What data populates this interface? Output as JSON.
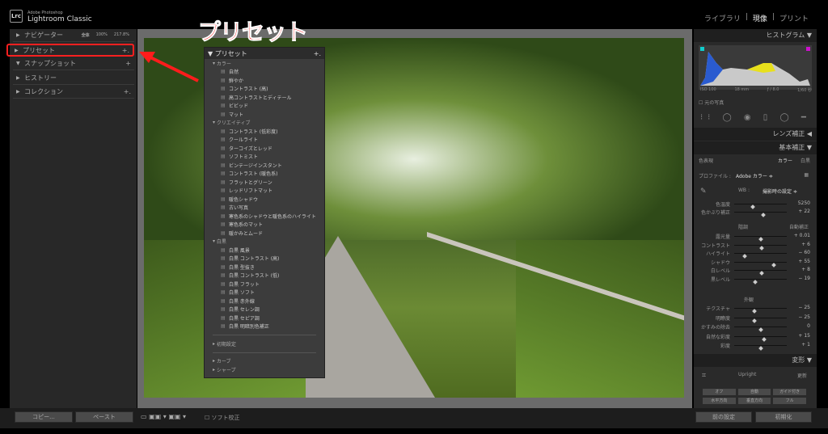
{
  "app": {
    "logo": "Lrc",
    "brand_small": "Adobe Photoshop",
    "brand": "Lightroom Classic",
    "modules": [
      "ライブラリ",
      "現像",
      "プリント"
    ],
    "active_module": "現像"
  },
  "annotation": {
    "title": "プリセット",
    "color": "#ff1c1c"
  },
  "left": {
    "navigator": {
      "label": "ナビゲーター",
      "fit": "全体",
      "z1": "100%",
      "z2": "217.8%"
    },
    "panels": [
      {
        "label": "プリセット",
        "plus": "+."
      },
      {
        "label": "スナップショット",
        "plus": "+"
      },
      {
        "label": "ヒストリー",
        "plus": ""
      },
      {
        "label": "コレクション",
        "plus": "+."
      }
    ]
  },
  "presets_popup": {
    "title": "プリセット",
    "plus": "+.",
    "groups": [
      {
        "name": "カラー",
        "items": [
          "自然",
          "鮮やか",
          "コントラスト (高)",
          "高コントラストとディテール",
          "ビビッド",
          "マット"
        ]
      },
      {
        "name": "クリエイティブ",
        "items": [
          "コントラスト (低彩度)",
          "クールライト",
          "ターコイズとレッド",
          "ソフトミスト",
          "ビンテージインスタント",
          "コントラスト (暖色系)",
          "フラットとグリーン",
          "レッドリフトマット",
          "暖色シャドウ",
          "古い写真",
          "寒色系のシャドウと暖色系のハイライト",
          "寒色系のマット",
          "暖かみとムード"
        ]
      },
      {
        "name": "白黒",
        "items": [
          "白黒 風景",
          "白黒 コントラスト (高)",
          "白黒 型抜き",
          "白黒 コントラスト (低)",
          "白黒 フラット",
          "白黒 ソフト",
          "白黒 赤外線",
          "白黒 セレン調",
          "白黒 セピア調",
          "白黒 明暗別色補正"
        ]
      }
    ],
    "collapsed": [
      "初期設定",
      "カーブ",
      "シャープ"
    ]
  },
  "right": {
    "histogram": {
      "title": "ヒストグラム",
      "iso": "ISO 100",
      "focal": "18 mm",
      "aperture": "ƒ / 8.0",
      "shutter": "1/60 秒",
      "original": "元の写真"
    },
    "lens": "レンズ補正",
    "basic": "基本補正",
    "treatment": {
      "label": "色表現",
      "color": "カラー",
      "bw": "白黒"
    },
    "profile": {
      "label": "プロファイル :",
      "value": "Adobe カラー ≑"
    },
    "wb": {
      "label": "WB :",
      "value": "撮影時の設定 ≑"
    },
    "sliders_wb": [
      {
        "label": "色温度",
        "value": "5250",
        "pos": 0.35
      },
      {
        "label": "色かぶり補正",
        "value": "+ 22",
        "pos": 0.55
      }
    ],
    "tone": {
      "label": "階調",
      "auto": "自動補正"
    },
    "sliders_tone": [
      {
        "label": "露光量",
        "value": "+ 0.01",
        "pos": 0.5
      },
      {
        "label": "コントラスト",
        "value": "+ 6",
        "pos": 0.53
      },
      {
        "label": "ハイライト",
        "value": "− 60",
        "pos": 0.2
      },
      {
        "label": "シャドウ",
        "value": "+ 55",
        "pos": 0.75
      },
      {
        "label": "白レベル",
        "value": "+ 8",
        "pos": 0.53
      },
      {
        "label": "黒レベル",
        "value": "− 19",
        "pos": 0.4
      }
    ],
    "presence": "外観",
    "sliders_presence": [
      {
        "label": "テクスチャ",
        "value": "− 25",
        "pos": 0.38
      },
      {
        "label": "明瞭度",
        "value": "− 25",
        "pos": 0.38
      },
      {
        "label": "かすみの除去",
        "value": "0",
        "pos": 0.5
      },
      {
        "label": "自然な彩度",
        "value": "+ 15",
        "pos": 0.57
      },
      {
        "label": "彩度",
        "value": "+ 1",
        "pos": 0.5
      }
    ],
    "transform": {
      "title": "変形",
      "upright": "Upright",
      "update": "更新",
      "buttons": [
        "オフ",
        "自動",
        "ガイド付き",
        "水平方向",
        "垂直方向",
        "フル"
      ]
    },
    "prev": "前の設定",
    "reset": "初期化"
  },
  "bottom": {
    "copy": "コピー...",
    "paste": "ペースト",
    "soft_proof": "ソフト校正"
  }
}
